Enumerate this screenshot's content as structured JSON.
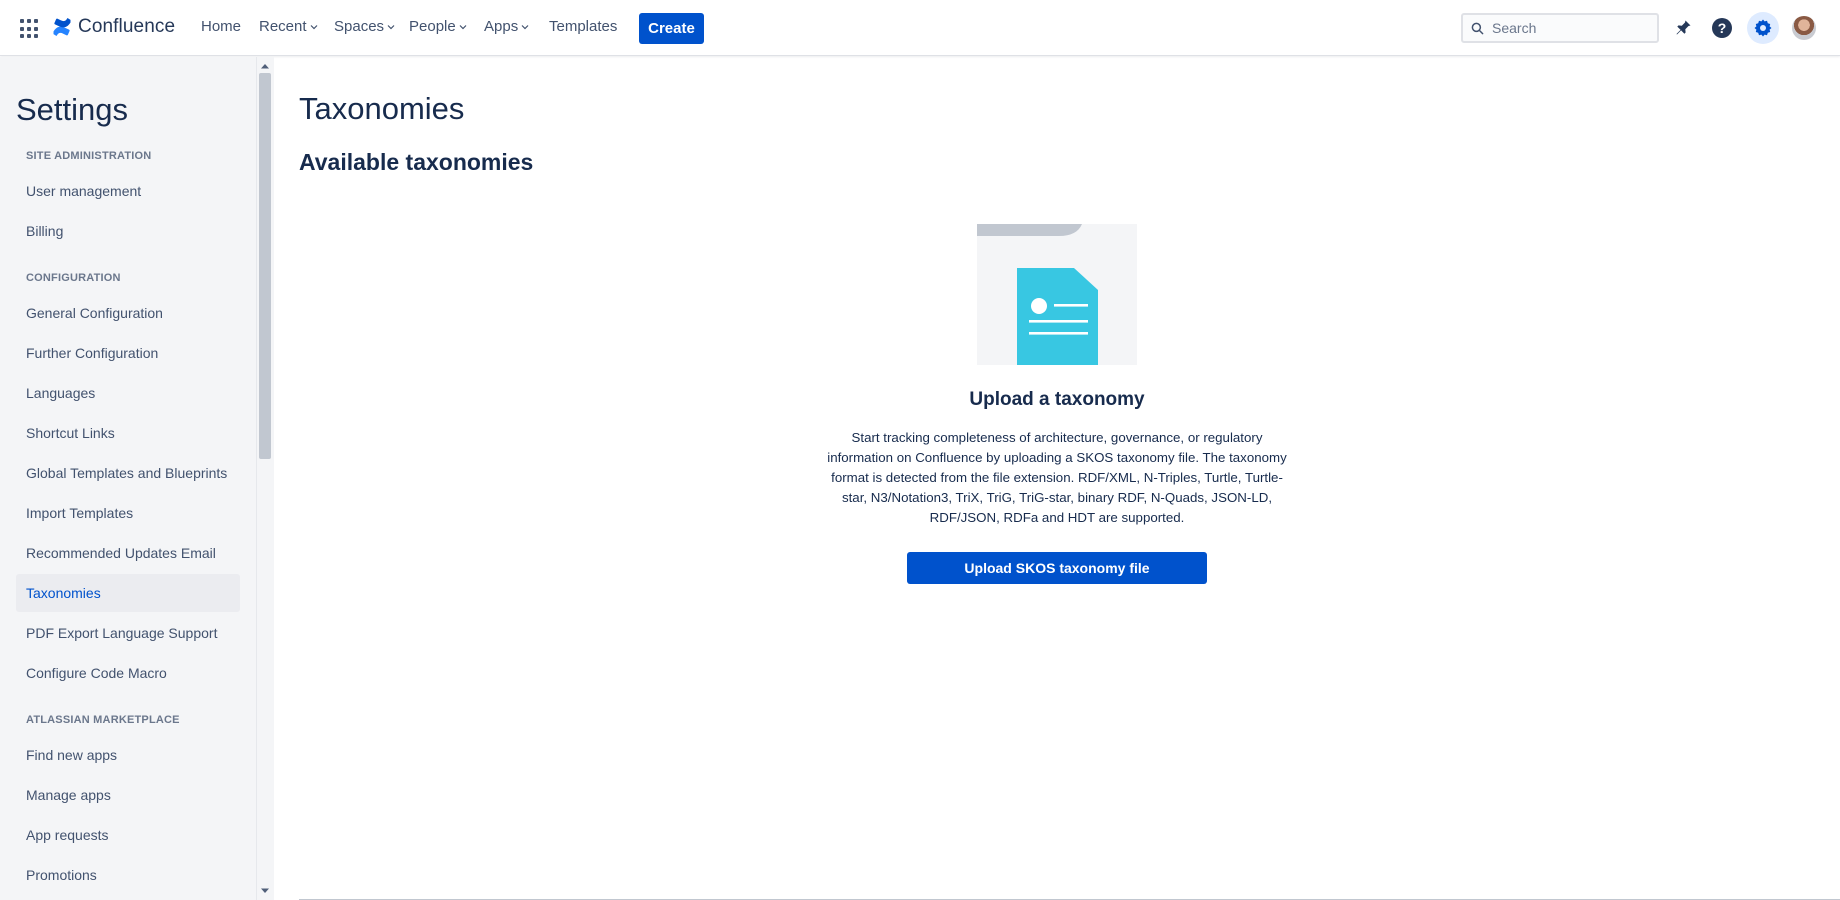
{
  "nav": {
    "app_name": "Confluence",
    "items": [
      {
        "label": "Home",
        "has_dropdown": false
      },
      {
        "label": "Recent",
        "has_dropdown": true
      },
      {
        "label": "Spaces",
        "has_dropdown": true
      },
      {
        "label": "People",
        "has_dropdown": true
      },
      {
        "label": "Apps",
        "has_dropdown": true
      },
      {
        "label": "Templates",
        "has_dropdown": false
      }
    ],
    "create_label": "Create",
    "search_placeholder": "Search",
    "icons": [
      "app-switcher-icon",
      "confluence-logo-icon",
      "notifications-icon",
      "help-icon",
      "settings-icon",
      "avatar"
    ],
    "accent_color": "#0052cc"
  },
  "sidebar": {
    "title": "Settings",
    "sections": [
      {
        "label": "SITE ADMINISTRATION",
        "items": [
          "User management",
          "Billing"
        ]
      },
      {
        "label": "CONFIGURATION",
        "items": [
          "General Configuration",
          "Further Configuration",
          "Languages",
          "Shortcut Links",
          "Global Templates and Blueprints",
          "Import Templates",
          "Recommended Updates Email",
          "Taxonomies",
          "PDF Export Language Support",
          "Configure Code Macro"
        ]
      },
      {
        "label": "ATLASSIAN MARKETPLACE",
        "items": [
          "Find new apps",
          "Manage apps",
          "App requests",
          "Promotions"
        ]
      }
    ],
    "active_item": "Taxonomies"
  },
  "main": {
    "title": "Taxonomies",
    "subtitle": "Available taxonomies",
    "empty_state": {
      "title": "Upload a taxonomy",
      "description": "Start tracking completeness of architecture, governance, or regulatory information on Confluence by uploading a SKOS taxonomy file. The taxonomy format is detected from the file extension. RDF/XML, N-Triples, Turtle, Turtle-star, N3/Notation3, TriX, TriG, TriG-star, binary RDF, N-Quads, JSON-LD, RDF/JSON, RDFa and HDT are supported.",
      "button_label": "Upload SKOS taxonomy file",
      "illustration": "document-icon",
      "illustration_color": "#38c7e2"
    }
  }
}
